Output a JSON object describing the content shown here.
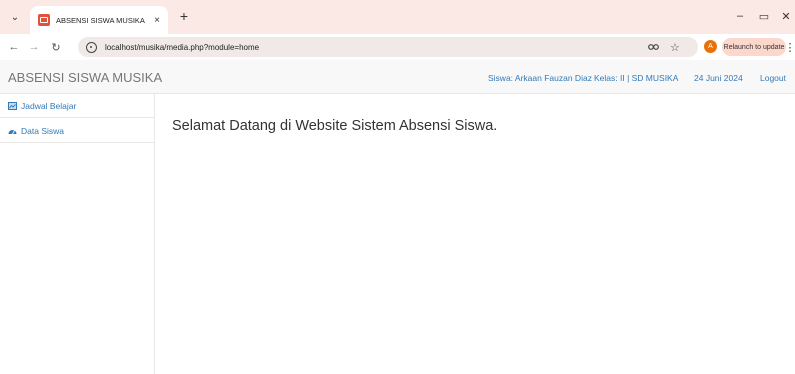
{
  "browser": {
    "tab_title": "ABSENSI SISWA MUSIKA",
    "tab_close": "×",
    "new_tab": "+",
    "url": "localhost/musika/media.php?module=home",
    "profile_initial": "A",
    "relaunch_label": "Relaunch to update",
    "window": {
      "minimize": "–",
      "restore": "▭",
      "close": "✕"
    },
    "nav": {
      "back": "←",
      "forward": "→",
      "reload": "↻",
      "tab_menu": "⌄"
    }
  },
  "navbar": {
    "brand": "ABSENSI SISWA MUSIKA",
    "student": "Siswa: Arkaan Fauzan Diaz",
    "class": "Kelas: II | SD MUSIKA",
    "date": "24 Juni 2024",
    "logout": "Logout"
  },
  "sidebar": {
    "items": [
      {
        "label": "Jadwal Belajar",
        "icon": "calendar-icon"
      },
      {
        "label": "Data Siswa",
        "icon": "dashboard-icon"
      }
    ]
  },
  "main": {
    "welcome": "Selamat Datang di Website Sistem Absensi Siswa."
  },
  "colors": {
    "link": "#337ab7",
    "brand": "#777777",
    "tabstrip": "#fae9e4",
    "favicon": "#e0533a",
    "profile": "#e8710a"
  }
}
